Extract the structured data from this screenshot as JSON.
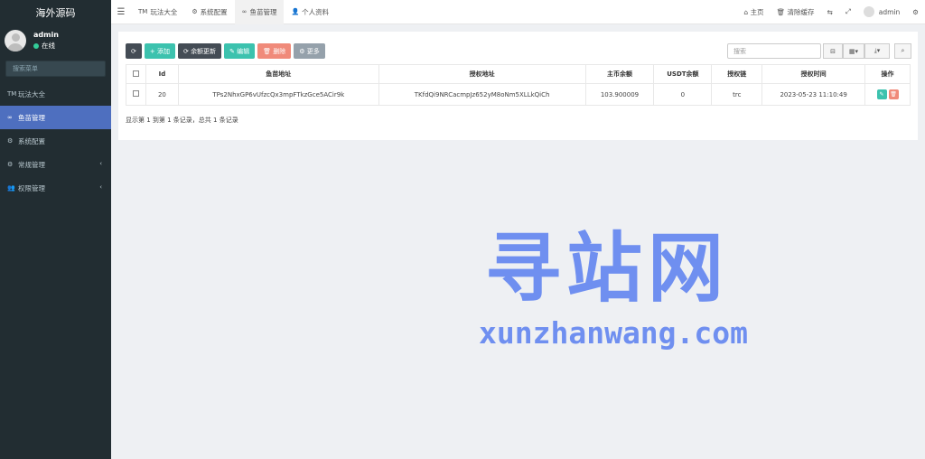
{
  "sidebar": {
    "brand": "海外源码",
    "user": {
      "name": "admin",
      "status": "在线"
    },
    "search_placeholder": "搜索菜单",
    "items": [
      {
        "icon": "TM",
        "label": "玩法大全"
      },
      {
        "icon": "∞",
        "label": "鱼苗管理"
      },
      {
        "icon": "⚙",
        "label": "系统配置"
      },
      {
        "icon": "⚙",
        "label": "常规管理",
        "arrow": "‹"
      },
      {
        "icon": "👥",
        "label": "权限管理",
        "arrow": "‹"
      }
    ]
  },
  "header": {
    "menu_icon": "☰",
    "tabs": [
      {
        "icon": "TM",
        "label": "玩法大全"
      },
      {
        "icon": "⚙",
        "label": "系统配置"
      },
      {
        "icon": "∞",
        "label": "鱼苗管理"
      },
      {
        "icon": "👤",
        "label": "个人资料"
      }
    ],
    "right": {
      "home": "主页",
      "clear_cache": "清除缓存",
      "user": "admin"
    }
  },
  "toolbar": {
    "refresh": "⟳",
    "add": "添加",
    "balance_update": "余额更新",
    "edit": "编辑",
    "delete": "删除",
    "more": "更多",
    "search_placeholder": "搜索"
  },
  "table": {
    "headers": [
      "Id",
      "鱼苗地址",
      "授权地址",
      "主币余额",
      "USDT余额",
      "授权链",
      "授权时间",
      "操作"
    ],
    "rows": [
      {
        "id": "20",
        "fish_address": "TPs2NhxGP6vUfzcQx3mpFTkzGce5ACir9k",
        "auth_address": "TKfdQi9NRCacmpJz652yM8oNm5XLLkQiCh",
        "main_balance": "103.900009",
        "usdt_balance": "0",
        "chain": "trc",
        "auth_time": "2023-05-23 11:10:49"
      }
    ],
    "summary": "显示第 1 到第 1 条记录，总共 1 条记录"
  },
  "watermark": {
    "title": "寻站网",
    "url": "xunzhanwang.com"
  }
}
